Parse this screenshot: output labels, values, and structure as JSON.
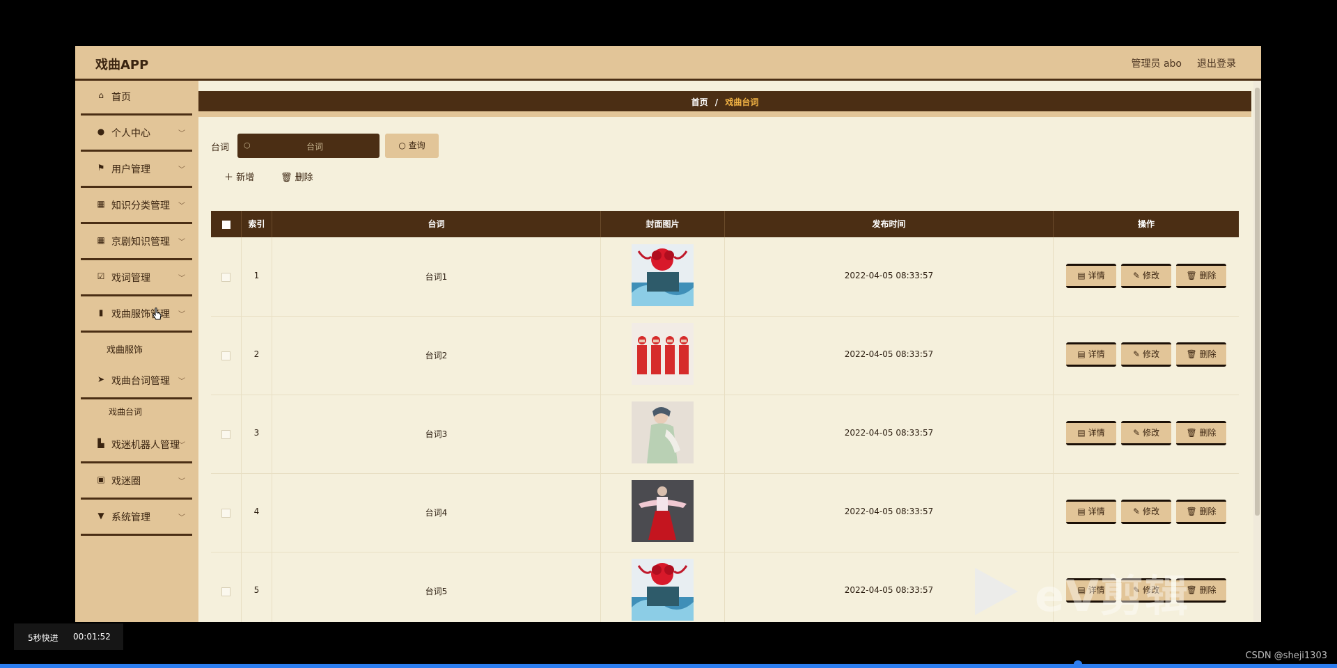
{
  "app": {
    "title": "戏曲APP",
    "user_label": "管理员 abo",
    "logout_label": "退出登录"
  },
  "sidebar": {
    "items": [
      {
        "icon": "home-icon",
        "label": "首页"
      },
      {
        "icon": "person-icon",
        "label": "个人中心"
      },
      {
        "icon": "flag-icon",
        "label": "用户管理"
      },
      {
        "icon": "grid-icon",
        "label": "知识分类管理"
      },
      {
        "icon": "grid-icon",
        "label": "京剧知识管理"
      },
      {
        "icon": "checkbox-icon",
        "label": "戏词管理"
      },
      {
        "icon": "bar-chart-icon",
        "label": "戏曲服饰管理"
      },
      {
        "icon": "send-icon",
        "label": "戏曲台词管理"
      },
      {
        "icon": "robot-icon",
        "label": "戏迷机器人管理"
      },
      {
        "icon": "clipboard-icon",
        "label": "戏迷圈"
      },
      {
        "icon": "settings-icon",
        "label": "系统管理"
      }
    ],
    "sub_costume": "戏曲服饰",
    "sub_lines": "戏曲台词"
  },
  "breadcrumb": {
    "home": "首页",
    "separator": "/",
    "current": "戏曲台词"
  },
  "search": {
    "label": "台词",
    "placeholder": "台词",
    "button": "查询"
  },
  "actions": {
    "add": "新增",
    "delete": "删除"
  },
  "table": {
    "headers": {
      "index": "索引",
      "lines": "台词",
      "cover": "封面图片",
      "time": "发布时间",
      "ops": "操作"
    },
    "rows": [
      {
        "index": "1",
        "lines": "台词1",
        "time": "2022-04-05 08:33:57"
      },
      {
        "index": "2",
        "lines": "台词2",
        "time": "2022-04-05 08:33:57"
      },
      {
        "index": "3",
        "lines": "台词3",
        "time": "2022-04-05 08:33:57"
      },
      {
        "index": "4",
        "lines": "台词4",
        "time": "2022-04-05 08:33:57"
      },
      {
        "index": "5",
        "lines": "台词5",
        "time": "2022-04-05 08:33:57"
      }
    ],
    "op_labels": {
      "detail": "详情",
      "edit": "修改",
      "delete": "删除"
    }
  },
  "player": {
    "speed": "5秒快进",
    "time": "00:01:52",
    "progress": 0.806
  },
  "watermark": "eV剪辑",
  "credit": "CSDN @sheji1303",
  "colors": {
    "header_brown": "#4b2e14",
    "tan": "#e2c598",
    "cream": "#f5f0dc",
    "accent_gold": "#f3b445"
  }
}
